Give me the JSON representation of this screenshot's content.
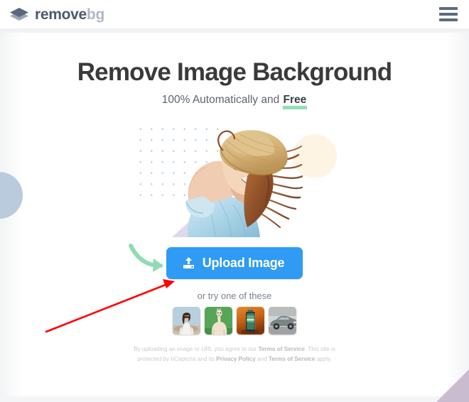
{
  "header": {
    "brand_primary": "remove",
    "brand_secondary": "bg",
    "logo_icon": "layers-diamond-icon",
    "menu_icon": "hamburger-menu-icon"
  },
  "hero": {
    "title": "Remove Image Background",
    "subtitle_prefix": "100% Automatically and ",
    "subtitle_highlight": "Free",
    "highlight_underline_color": "#8ee0b2",
    "image_alt": "woman-with-straw-hat-and-sunglasses"
  },
  "upload": {
    "button_label": "Upload Image",
    "button_icon": "upload-icon",
    "button_color": "#2f9bf4",
    "hint_arrow_color": "#8fdcb4"
  },
  "samples": {
    "caption": "or try one of these",
    "thumbs": [
      {
        "name": "sample-thumb-woman",
        "alt": "woman in white t-shirt"
      },
      {
        "name": "sample-thumb-alpaca",
        "alt": "alpaca on green background"
      },
      {
        "name": "sample-thumb-product",
        "alt": "product bottle on orange background"
      },
      {
        "name": "sample-thumb-car",
        "alt": "grey car"
      }
    ]
  },
  "legal": {
    "line1_a": "By uploading an image or URL you agree to our ",
    "link_tos_1": "Terms of Service",
    "line1_b": ". This site is",
    "line2_a": "protected by hCaptcha and its ",
    "link_privacy": "Privacy Policy",
    "line2_b": " and ",
    "link_tos_2": "Terms of Service",
    "line2_c": " apply."
  },
  "annotation": {
    "arrow_color": "#fe0000",
    "points_to": "upload-image-button"
  }
}
